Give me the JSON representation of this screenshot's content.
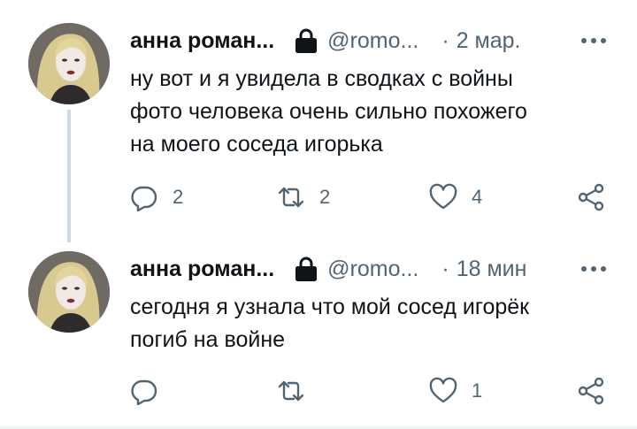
{
  "colors": {
    "text_primary": "#0f1419",
    "text_secondary": "#536471",
    "thread_line": "#cfd9de",
    "background": "#ffffff"
  },
  "tweets": [
    {
      "author_name": "анна роман...",
      "handle": "@romo...",
      "separator": "·",
      "time": "2 мар.",
      "text_lines": [
        "ну вот и я увидела в сводках с войны",
        "фото человека очень сильно похожего",
        "на моего соседа игорька"
      ],
      "reply_count": "2",
      "retweet_count": "2",
      "like_count": "4",
      "icons": [
        "lock-icon",
        "more-icon",
        "reply-icon",
        "retweet-icon",
        "like-icon",
        "share-icon"
      ]
    },
    {
      "author_name": "анна роман...",
      "handle": "@romo...",
      "separator": "·",
      "time": "18 мин",
      "text_lines": [
        "сегодня я узнала что мой сосед игорёк",
        "погиб на войне"
      ],
      "reply_count": "",
      "retweet_count": "",
      "like_count": "1",
      "icons": [
        "lock-icon",
        "more-icon",
        "reply-icon",
        "retweet-icon",
        "like-icon",
        "share-icon"
      ]
    }
  ]
}
